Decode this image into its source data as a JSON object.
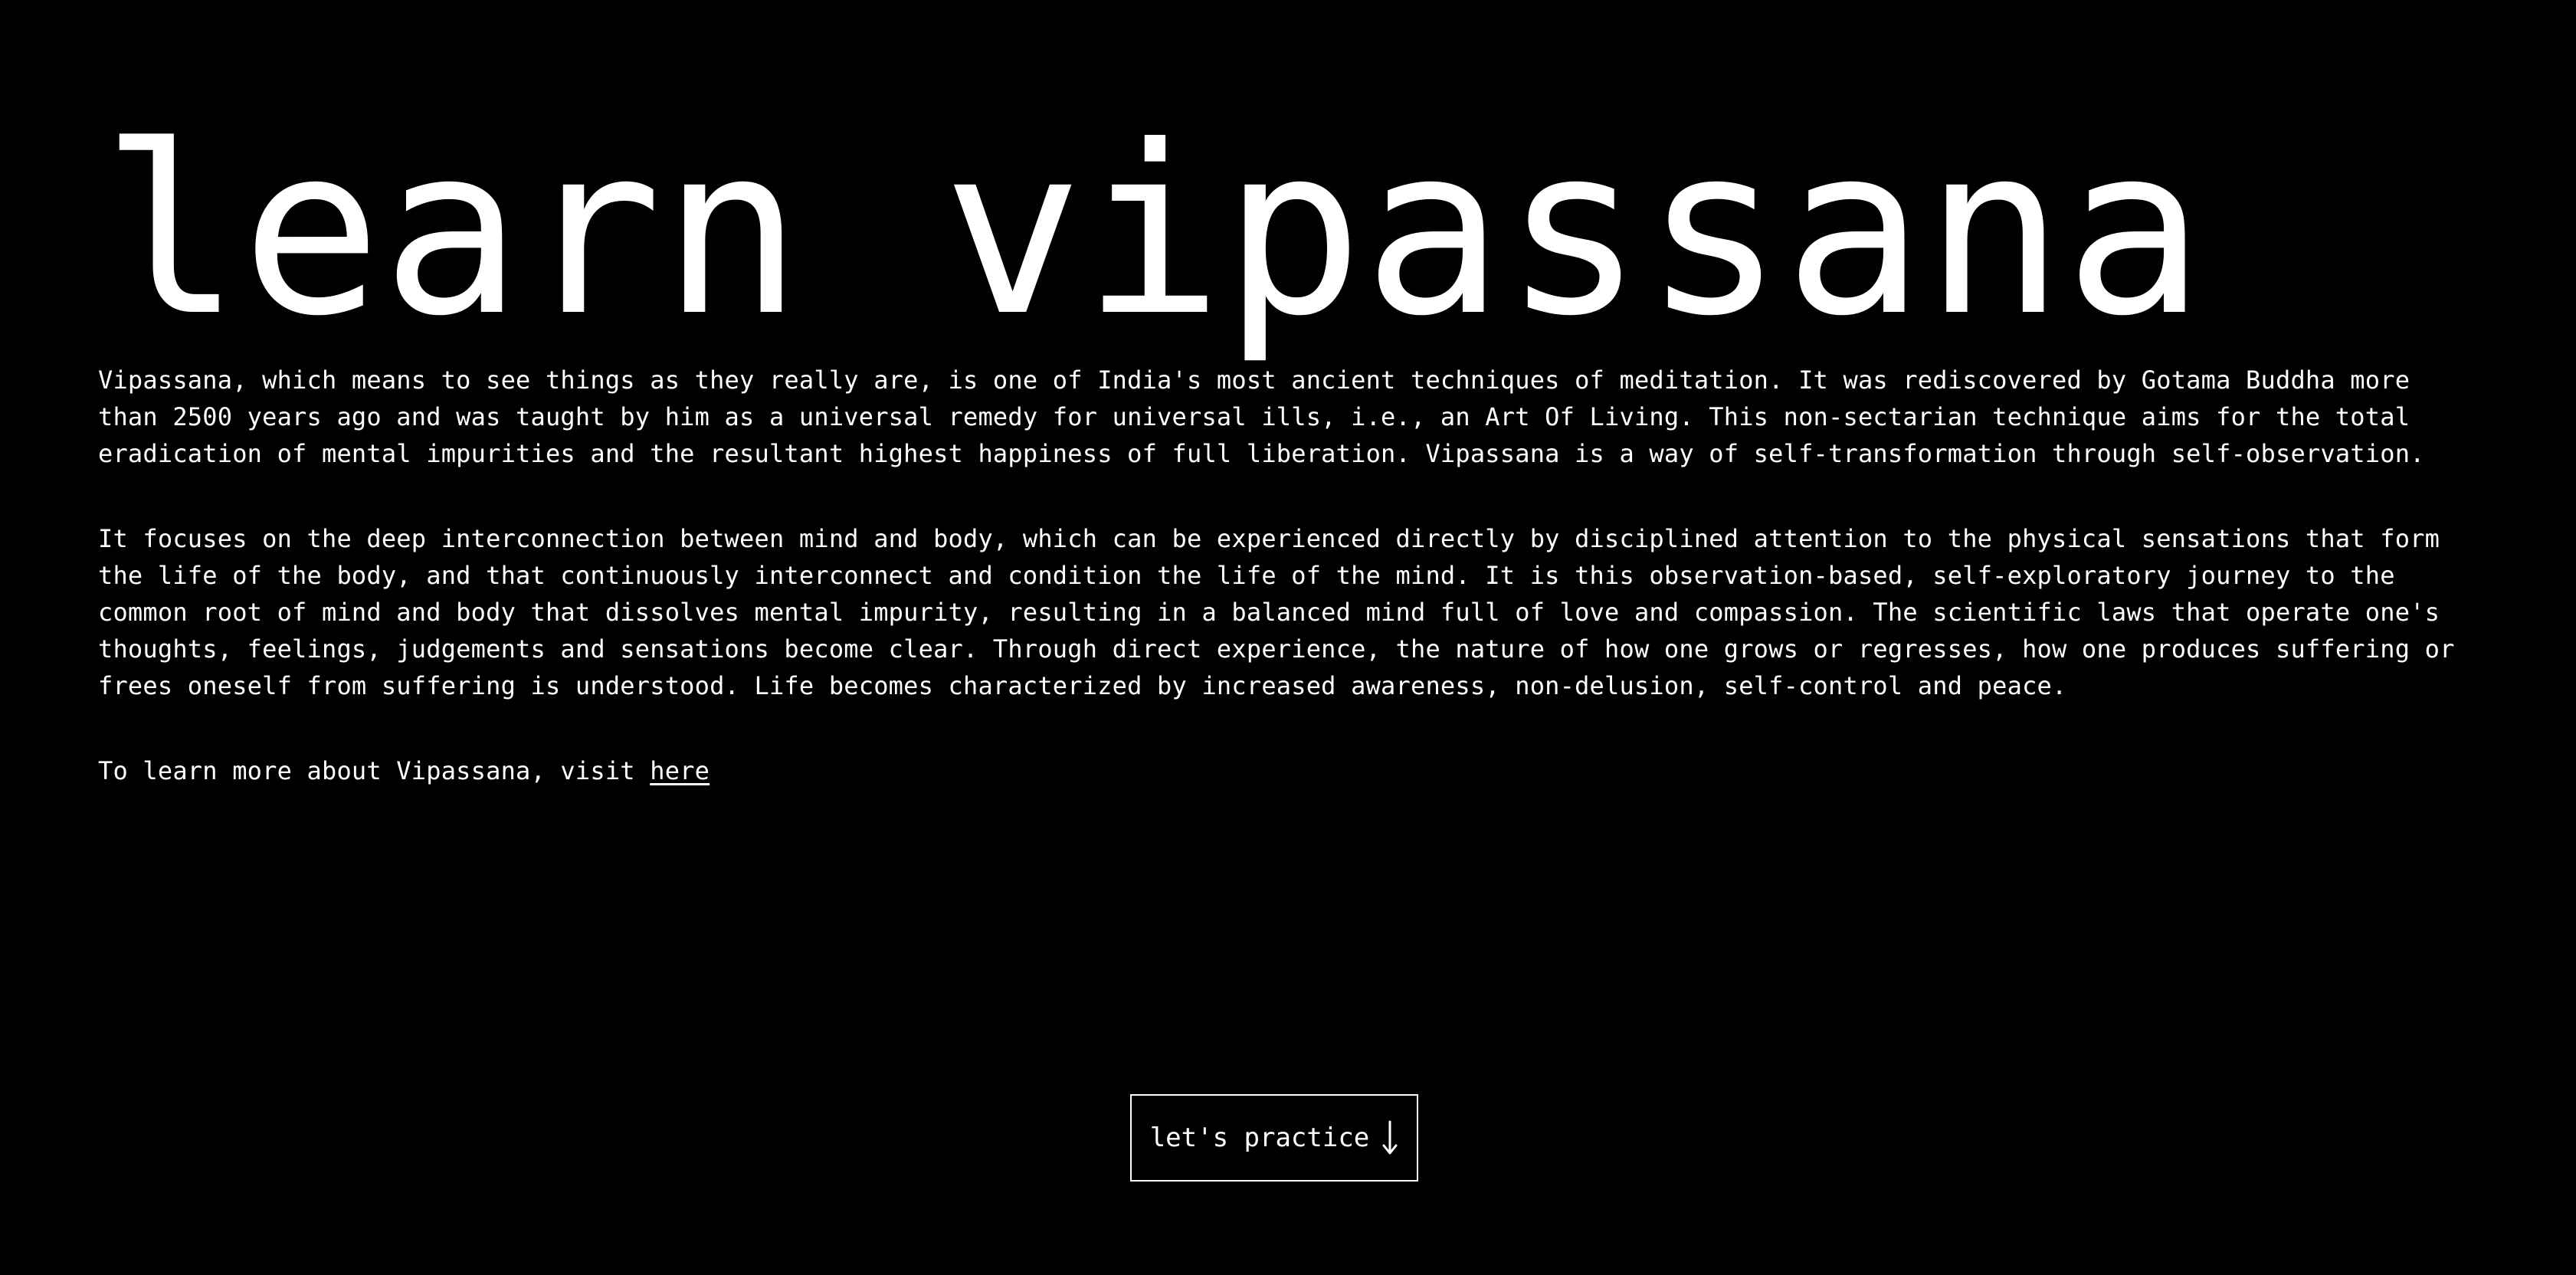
{
  "page": {
    "title": "learn vipassana"
  },
  "content": {
    "paragraphs": [
      "Vipassana, which means to see things as they really are, is one of India's most ancient techniques of meditation. It was rediscovered by Gotama Buddha more than 2500 years ago and was taught by him as a universal remedy for universal ills, i.e., an Art Of Living. This non-sectarian technique aims for the total eradication of mental impurities and the resultant highest happiness of full liberation. Vipassana is a way of self-transformation through self-observation.",
      "It focuses on the deep interconnection between mind and body, which can be experienced directly by disciplined attention to the physical sensations that form the life of the body, and that continuously interconnect and condition the life of the mind. It is this observation-based, self-exploratory journey to the common root of mind and body that dissolves mental impurity, resulting in a balanced mind full of love and compassion. The scientific laws that operate one's thoughts, feelings, judgements and sensations become clear. Through direct experience, the nature of how one grows or regresses, how one produces suffering or frees oneself from suffering is understood. Life becomes characterized by increased awareness, non-delusion, self-control and peace."
    ],
    "learn_more_prefix": "To learn more about Vipassana, visit ",
    "learn_more_link": "here"
  },
  "cta": {
    "label": "let's practice",
    "icon": "arrow-down-icon"
  },
  "colors": {
    "background": "#000000",
    "text": "#ffffff"
  }
}
